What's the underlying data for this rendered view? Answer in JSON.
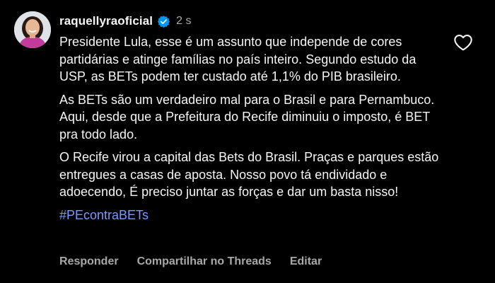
{
  "comment": {
    "username": "raquellyraoficial",
    "verified_icon": "verified-badge-icon",
    "timestamp": "2 s",
    "paragraphs": [
      "Presidente Lula, esse é um assunto que independe de cores partidárias e atinge famílias no país inteiro. Segundo estudo da USP, as BETs podem ter custado até 1,1% do PIB brasileiro.",
      "As BETs são um verdadeiro mal  para o Brasil e para Pernambuco. Aqui, desde que a Prefeitura do Recife diminuiu o imposto, é BET pra todo lado.",
      "O Recife virou a capital das Bets do Brasil. Praças e parques estão entregues a casas de aposta. Nosso povo tá endividado e adoecendo, É preciso juntar as forças e dar um basta nisso!"
    ],
    "hashtag": "#PEcontraBETs",
    "like_icon": "heart-outline-icon",
    "actions": {
      "reply": "Responder",
      "share_threads": "Compartilhar no Threads",
      "edit": "Editar"
    }
  },
  "colors": {
    "background": "#000000",
    "text": "#f5f5f5",
    "muted": "#a8a8a8",
    "link": "#7899ff",
    "verified": "#0095f6"
  }
}
